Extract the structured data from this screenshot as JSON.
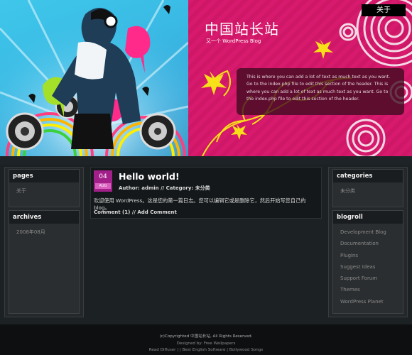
{
  "header": {
    "about_tab": "关于",
    "site_title": "中国站长站",
    "site_description": "又一个 WordPress Blog",
    "intro_text": "This is where you can add a lot of text as much text as you want. Go to the index.php file to edit this section of the header. This is where you can add a lot of text as much text as you want. Go to the index.php file to edit this section of the header."
  },
  "colors": {
    "accent_pink": "#d81a6e",
    "badge_purple": "#a3208a",
    "sky_blue": "#3fc7ea"
  },
  "sidebar_left": {
    "pages": {
      "title": "pages",
      "items": [
        "关于"
      ]
    },
    "archives": {
      "title": "archives",
      "items": [
        "2008年08月"
      ]
    }
  },
  "sidebar_right": {
    "categories": {
      "title": "categories",
      "items": [
        "未分类"
      ]
    },
    "blogroll": {
      "title": "blogroll",
      "items": [
        "Development Blog",
        "Documentation",
        "Plugins",
        "Suggest Ideas",
        "Support Forum",
        "Themes",
        "WordPress Planet"
      ]
    }
  },
  "post": {
    "day": "04",
    "month": "AUG",
    "title": "Hello world!",
    "author_label": "Author:",
    "author": "admin",
    "category_label": "Category:",
    "category": "未分类",
    "body": "欢迎使用 WordPress。这是您的第一篇日志。您可以编辑它或是删除它，然后开始写您自己的 blog。",
    "comments": "Comment (1)",
    "add_comment": "Add Comment",
    "separator": "//"
  },
  "footer": {
    "line1": "(c)Copyrighted 中国站长站, All Rights Reserved.",
    "line2": "Designed by: Free Wallpapers",
    "line3": "Read Diffuser | | Best English Software | Bollywood Songs"
  }
}
